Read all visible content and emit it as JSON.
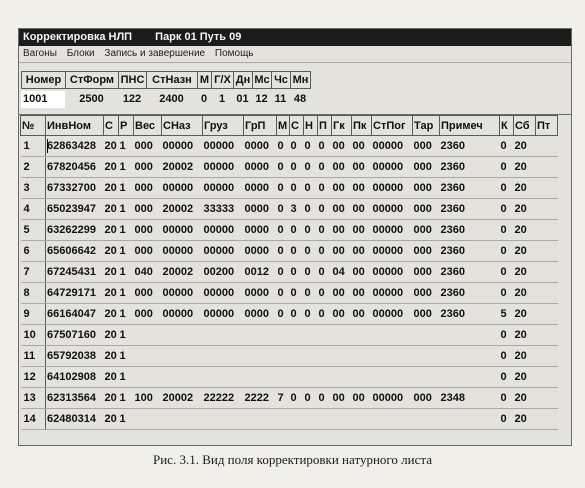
{
  "window": {
    "title": "Корректировка НЛП",
    "subtitle": "Парк 01 Путь 09"
  },
  "menu": [
    "Вагоны",
    "Блоки",
    "Запись и завершение",
    "Помощь"
  ],
  "header_fields": [
    {
      "label": "Номер",
      "value": "1001"
    },
    {
      "label": "СтФорм",
      "value": "2500"
    },
    {
      "label": "ПНС",
      "value": "122"
    },
    {
      "label": "СтНазн",
      "value": "2400"
    },
    {
      "label": "М",
      "value": "0"
    },
    {
      "label": "Г/Х",
      "value": "1"
    },
    {
      "label": "Дн",
      "value": "01"
    },
    {
      "label": "Мс",
      "value": "12"
    },
    {
      "label": "Чс",
      "value": "11"
    },
    {
      "label": "Мн",
      "value": "48"
    }
  ],
  "table": {
    "columns": [
      "№",
      "ИнвНом",
      "С",
      "Р",
      "Вес",
      "СНаз",
      "Груз",
      "ГрП",
      "М",
      "С",
      "Н",
      "П",
      "Гк",
      "Пк",
      "СтПог",
      "Тар",
      "Примеч",
      "К",
      "Сб",
      "Пт"
    ],
    "rows": [
      [
        "1",
        "62863428",
        "20",
        "1",
        "000",
        "00000",
        "00000",
        "0000",
        "0",
        "0",
        "0",
        "0",
        "00",
        "00",
        "00000",
        "000",
        "2360",
        "0",
        "20",
        ""
      ],
      [
        "2",
        "67820456",
        "20",
        "1",
        "000",
        "20002",
        "00000",
        "0000",
        "0",
        "0",
        "0",
        "0",
        "00",
        "00",
        "00000",
        "000",
        "2360",
        "0",
        "20",
        ""
      ],
      [
        "3",
        "67332700",
        "20",
        "1",
        "000",
        "00000",
        "00000",
        "0000",
        "0",
        "0",
        "0",
        "0",
        "00",
        "00",
        "00000",
        "000",
        "2360",
        "0",
        "20",
        ""
      ],
      [
        "4",
        "65023947",
        "20",
        "1",
        "000",
        "20002",
        "33333",
        "0000",
        "0",
        "3",
        "0",
        "0",
        "00",
        "00",
        "00000",
        "000",
        "2360",
        "0",
        "20",
        ""
      ],
      [
        "5",
        "63262299",
        "20",
        "1",
        "000",
        "00000",
        "00000",
        "0000",
        "0",
        "0",
        "0",
        "0",
        "00",
        "00",
        "00000",
        "000",
        "2360",
        "0",
        "20",
        ""
      ],
      [
        "6",
        "65606642",
        "20",
        "1",
        "000",
        "00000",
        "00000",
        "0000",
        "0",
        "0",
        "0",
        "0",
        "00",
        "00",
        "00000",
        "000",
        "2360",
        "0",
        "20",
        ""
      ],
      [
        "7",
        "67245431",
        "20",
        "1",
        "040",
        "20002",
        "00200",
        "0012",
        "0",
        "0",
        "0",
        "0",
        "04",
        "00",
        "00000",
        "000",
        "2360",
        "0",
        "20",
        ""
      ],
      [
        "8",
        "64729171",
        "20",
        "1",
        "000",
        "00000",
        "00000",
        "0000",
        "0",
        "0",
        "0",
        "0",
        "00",
        "00",
        "00000",
        "000",
        "2360",
        "0",
        "20",
        ""
      ],
      [
        "9",
        "66164047",
        "20",
        "1",
        "000",
        "00000",
        "00000",
        "0000",
        "0",
        "0",
        "0",
        "0",
        "00",
        "00",
        "00000",
        "000",
        "2360",
        "5",
        "20",
        ""
      ],
      [
        "10",
        "67507160",
        "20",
        "1",
        "",
        "",
        "",
        "",
        "",
        "",
        "",
        "",
        "",
        "",
        "",
        "",
        "",
        "0",
        "20",
        ""
      ],
      [
        "11",
        "65792038",
        "20",
        "1",
        "",
        "",
        "",
        "",
        "",
        "",
        "",
        "",
        "",
        "",
        "",
        "",
        "",
        "0",
        "20",
        ""
      ],
      [
        "12",
        "64102908",
        "20",
        "1",
        "",
        "",
        "",
        "",
        "",
        "",
        "",
        "",
        "",
        "",
        "",
        "",
        "",
        "0",
        "20",
        ""
      ],
      [
        "13",
        "62313564",
        "20",
        "1",
        "100",
        "20002",
        "22222",
        "2222",
        "7",
        "0",
        "0",
        "0",
        "00",
        "00",
        "00000",
        "000",
        "2348",
        "0",
        "20",
        ""
      ],
      [
        "14",
        "62480314",
        "20",
        "1",
        "",
        "",
        "",
        "",
        "",
        "",
        "",
        "",
        "",
        "",
        "",
        "",
        "",
        "0",
        "20",
        ""
      ]
    ]
  },
  "caption": "Рис. 3.1. Вид поля корректировки натурного листа"
}
